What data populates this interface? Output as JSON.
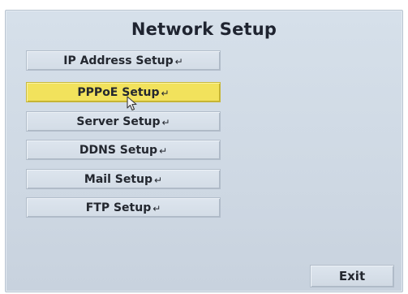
{
  "window": {
    "title": "Network Setup"
  },
  "menu": {
    "items": [
      {
        "label": "IP Address Setup",
        "selected": false
      },
      {
        "label": "PPPoE Setup",
        "selected": true
      },
      {
        "label": "Server Setup",
        "selected": false
      },
      {
        "label": "DDNS Setup",
        "selected": false
      },
      {
        "label": "Mail Setup",
        "selected": false
      },
      {
        "label": "FTP Setup",
        "selected": false
      }
    ],
    "enter_glyph": "↵"
  },
  "footer": {
    "exit_label": "Exit"
  },
  "colors": {
    "selected_highlight": "#f2e25c",
    "panel_background": "#d3dce6"
  },
  "icons": {
    "enter": "enter-return-icon",
    "pointer": "mouse-pointer-icon"
  }
}
